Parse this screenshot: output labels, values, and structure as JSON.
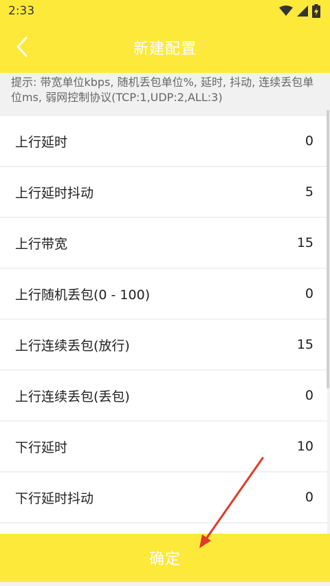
{
  "status_bar": {
    "time": "2:33",
    "icons": [
      "wifi-icon",
      "signal-icon",
      "battery-charging-icon"
    ]
  },
  "header": {
    "title": "新建配置",
    "back_icon": "chevron-left-icon"
  },
  "hint": {
    "text": "提示: 带宽单位kbps, 随机丢包单位%, 延时, 抖动, 连续丢包单位ms, 弱网控制协议(TCP:1,UDP:2,ALL:3)"
  },
  "settings": {
    "items": [
      {
        "label": "上行延时",
        "value": "0"
      },
      {
        "label": "上行延时抖动",
        "value": "5"
      },
      {
        "label": "上行带宽",
        "value": "15"
      },
      {
        "label": "上行随机丢包(0 - 100)",
        "value": "0"
      },
      {
        "label": "上行连续丢包(放行)",
        "value": "15"
      },
      {
        "label": "上行连续丢包(丢包)",
        "value": "0"
      },
      {
        "label": "下行延时",
        "value": "10"
      },
      {
        "label": "下行延时抖动",
        "value": "0"
      },
      {
        "label": "",
        "value": ""
      }
    ]
  },
  "confirm": {
    "label": "确定"
  },
  "colors": {
    "accent": "#fde93a",
    "annotation_arrow": "#e03a2a"
  }
}
